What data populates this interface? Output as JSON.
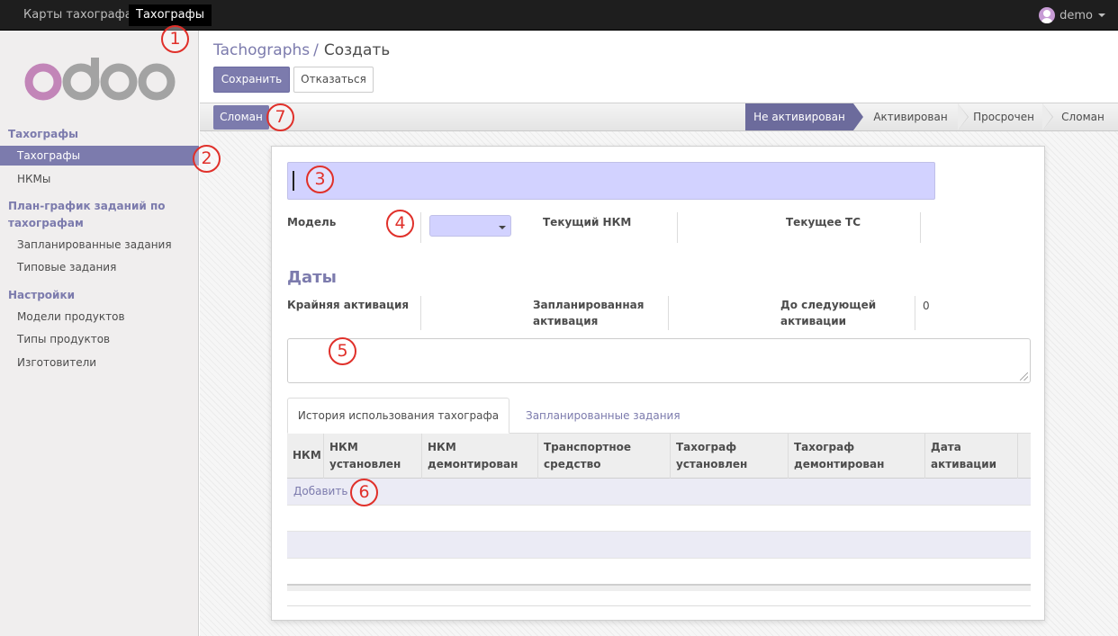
{
  "topbar": {
    "menus": [
      "Карты тахографа",
      "Тахографы"
    ],
    "active_menu": "Тахографы",
    "user": "demo"
  },
  "sidebar": {
    "logo_text": "odoo",
    "sections": [
      {
        "title": "Тахографы",
        "items": [
          "Тахографы",
          "НКМы"
        ]
      },
      {
        "title": "План-график заданий по тахографам",
        "items": [
          "Запланированные задания",
          "Типовые задания"
        ]
      },
      {
        "title": "Настройки",
        "items": [
          "Модели продуктов",
          "Типы продуктов",
          "Изготовители"
        ]
      }
    ],
    "active_item": "Тахографы"
  },
  "breadcrumb": {
    "parent": "Tachographs",
    "separator": "/",
    "current": "Создать"
  },
  "buttons": {
    "save": "Сохранить",
    "cancel": "Отказаться"
  },
  "statusbar": {
    "broken_button": "Сломан",
    "stages": [
      "Не активирован",
      "Активирован",
      "Просрочен",
      "Сломан"
    ],
    "active_stage": "Не активирован"
  },
  "form": {
    "name_value": "",
    "fields": {
      "model": "Модель",
      "current_nkm": "Текущий НКМ",
      "current_vehicle": "Текущее ТС"
    },
    "dates_title": "Даты",
    "date_fields": {
      "last_activation": "Крайняя активация",
      "planned_activation_line1": "Запланированная",
      "planned_activation_line2": "активация",
      "until_next_line1": "До следующей",
      "until_next_line2": "активации",
      "until_next_value": "0"
    },
    "notes_value": ""
  },
  "tabs": {
    "active": "История использования тахографа",
    "other": "Запланированные задания"
  },
  "table": {
    "columns": [
      [
        "НКМ",
        ""
      ],
      [
        "НКМ",
        "установлен"
      ],
      [
        "НКМ",
        "демонтирован"
      ],
      [
        "Транспортное",
        "средство"
      ],
      [
        "Тахограф",
        "установлен"
      ],
      [
        "Тахограф",
        "демонтирован"
      ],
      [
        "Дата",
        "активации"
      ]
    ],
    "add_link": "Добавить"
  },
  "annotations": [
    "1",
    "2",
    "3",
    "4",
    "5",
    "6",
    "7"
  ],
  "colors": {
    "accent": "#7c7bad",
    "required_field": "#d2d2ff",
    "marker": "#e0302a",
    "topbar": "#1e1e1e"
  }
}
